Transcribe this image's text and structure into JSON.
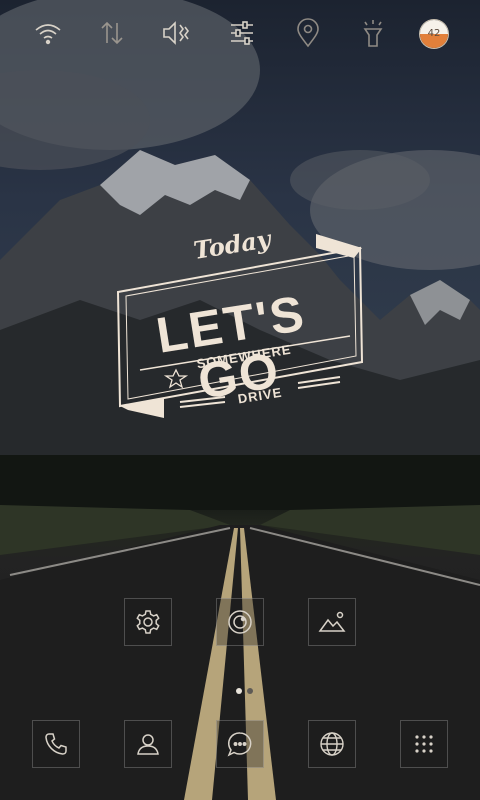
{
  "status_bar": {
    "icons": [
      "wifi-icon",
      "data-transfer-icon",
      "vibrate-icon",
      "sliders-icon",
      "location-icon",
      "flashlight-icon"
    ],
    "battery_value": "42"
  },
  "widget": {
    "today": "Today",
    "headline": "LET'S GO",
    "tagline": "SOMEWHERE",
    "sub": "DRIVE"
  },
  "home_apps": [
    "settings-icon",
    "camera-icon",
    "gallery-icon"
  ],
  "page_indicator": {
    "pages": 2,
    "active": 1
  },
  "dock": [
    "phone-icon",
    "contacts-icon",
    "messages-icon",
    "browser-icon",
    "app-drawer-icon"
  ],
  "colors": {
    "text": "#efe4d6",
    "icon": "#d8d2c8",
    "battery_fill": "#e2803a"
  }
}
